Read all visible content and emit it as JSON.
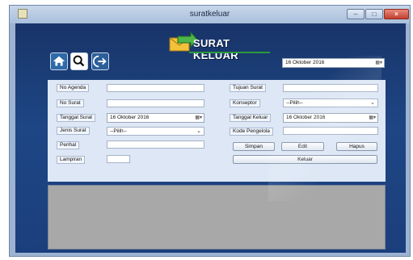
{
  "window": {
    "title": "suratkeluar",
    "close_glyph": "×",
    "min_glyph": "–",
    "max_glyph": "□"
  },
  "header": {
    "logo_text": "SURAT KELUAR",
    "top_date": "16  Oktober  2016"
  },
  "toolbar": {
    "home_icon": "home-icon",
    "search_icon": "search-icon",
    "logout_icon": "logout-icon"
  },
  "form": {
    "no_agenda": {
      "label": "No Agenda",
      "value": ""
    },
    "no_surat": {
      "label": "No Surat",
      "value": ""
    },
    "tanggal_surat": {
      "label": "Tanggal Surat",
      "value": "16  Oktober  2016"
    },
    "jenis_surat": {
      "label": "Jenis Surat",
      "value": "--Pilih--"
    },
    "perihal": {
      "label": "Perihal",
      "value": ""
    },
    "lampiran": {
      "label": "Lampiran",
      "value": ""
    },
    "tujuan_surat": {
      "label": "Tujuan Surat",
      "value": ""
    },
    "konseptor": {
      "label": "Konseptor",
      "value": "--Pilih--"
    },
    "tanggal_keluar": {
      "label": "Tanggal Keluar",
      "value": "16  Oktober  2016"
    },
    "kode_pengelola": {
      "label": "Kode Pengelola",
      "value": ""
    }
  },
  "buttons": {
    "simpan": "Simpan",
    "edit": "Edit",
    "hapus": "Hapus",
    "keluar": "Keluar"
  },
  "colors": {
    "background": "#1e4684",
    "panel": "#dde7f5",
    "grid": "#a8a8a8",
    "logo_accent": "#2c9a3c"
  },
  "dropdown_glyph": "⌄",
  "calendar_glyph": "▦▾"
}
